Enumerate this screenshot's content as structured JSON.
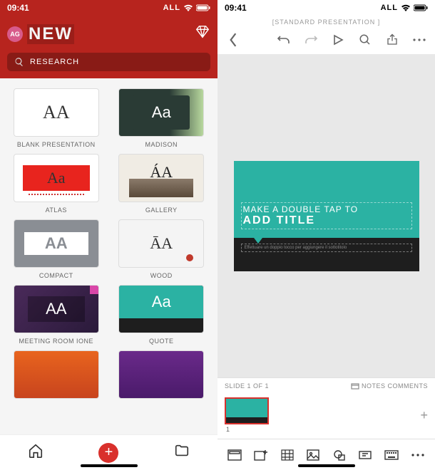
{
  "status": {
    "time": "09:41",
    "signal": "ALL"
  },
  "left_header": {
    "avatar": "AG",
    "title": "NEW",
    "search_placeholder": "RESEARCH"
  },
  "templates": [
    {
      "name": "BLANK PRESENTATION"
    },
    {
      "name": "MADISON"
    },
    {
      "name": "ATLAS"
    },
    {
      "name": "GALLERY"
    },
    {
      "name": "COMPACT"
    },
    {
      "name": "WOOD"
    },
    {
      "name": "MEETING ROOM IONE"
    },
    {
      "name": "QUOTE"
    }
  ],
  "right": {
    "doc_title": "[STANDARD PRESENTATION ]",
    "slide_hint1": "MAKE A DOUBLE TAP TO",
    "slide_hint2": "ADD TITLE",
    "slide_sub": "Effettuare un doppio tocco per aggiungere il sottotitolo",
    "slide_counter": "SLIDE 1 OF 1",
    "notes_label": "NOTES COMMENTS",
    "slide_number": "1"
  }
}
